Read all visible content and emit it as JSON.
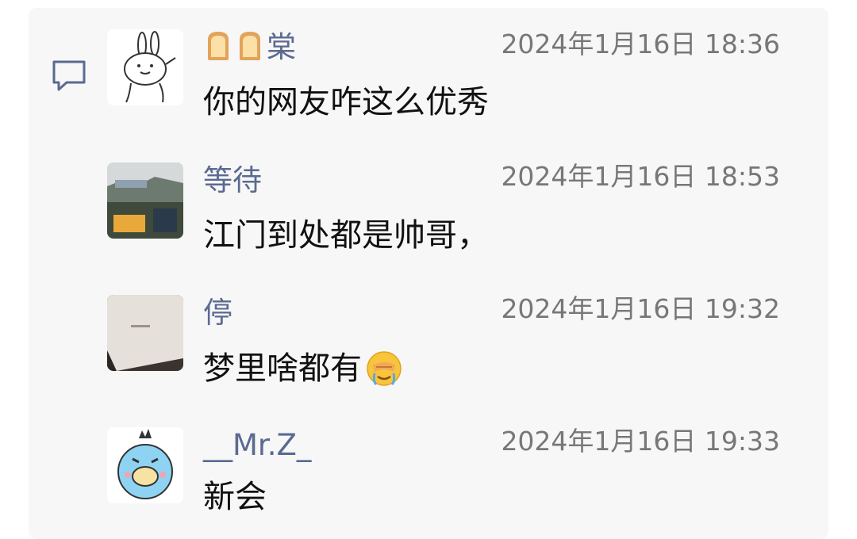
{
  "comments": [
    {
      "nickname_prefix_icons": [
        "bread-icon",
        "bread-icon"
      ],
      "nickname": "棠",
      "timestamp": "2024年1月16日 18:36",
      "text": "你的网友咋这么优秀"
    },
    {
      "nickname": "等待",
      "timestamp": "2024年1月16日 18:53",
      "text": "江门到处都是帅哥，"
    },
    {
      "nickname": "停",
      "timestamp": "2024年1月16日 19:32",
      "text": "梦里啥都有",
      "trailing_emoji": "facepalm-cry-emoji"
    },
    {
      "nickname": "__Mr.Z_",
      "timestamp": "2024年1月16日 19:33",
      "text": "新会"
    }
  ],
  "colors": {
    "nickname": "#5b6a91",
    "timestamp": "#777777",
    "text": "#111111",
    "panel_background": "#f7f7f7"
  }
}
